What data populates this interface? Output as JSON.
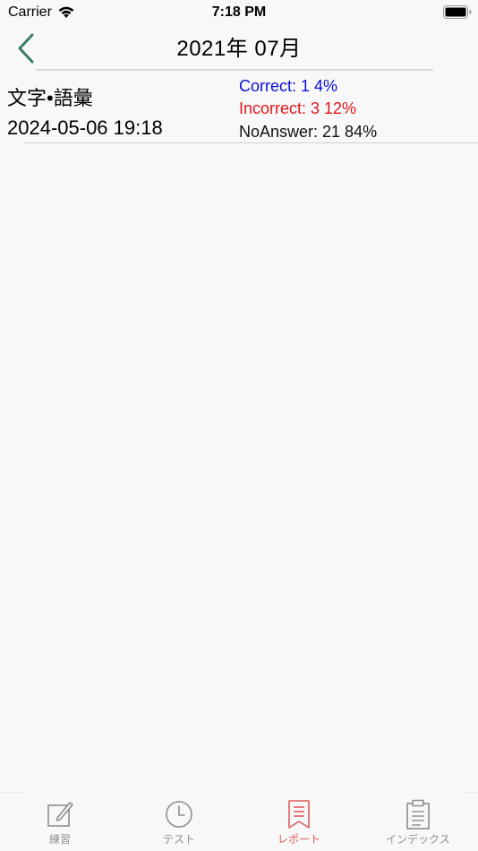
{
  "status_bar": {
    "carrier": "Carrier",
    "time": "7:18 PM"
  },
  "nav": {
    "title": "2021年 07月",
    "back_icon": "chevron-left-icon"
  },
  "report": {
    "category": "文字•語彙",
    "datetime": "2024-05-06 19:18",
    "correct": "Correct: 1  4%",
    "incorrect": "Incorrect: 3  12%",
    "no_answer": "NoAnswer: 21  84%"
  },
  "tabs": [
    {
      "label": "練習",
      "icon": "edit-icon",
      "active": false
    },
    {
      "label": "テスト",
      "icon": "clock-icon",
      "active": false
    },
    {
      "label": "レポート",
      "icon": "bookmark-icon",
      "active": true
    },
    {
      "label": "インデックス",
      "icon": "clipboard-icon",
      "active": false
    }
  ],
  "colors": {
    "background": "#f8f8f8",
    "back_chevron": "#3d7a66",
    "correct": "#0a10d8",
    "incorrect": "#e0151b",
    "tab_inactive": "#8e8e8e",
    "tab_active": "#e15b5b"
  }
}
